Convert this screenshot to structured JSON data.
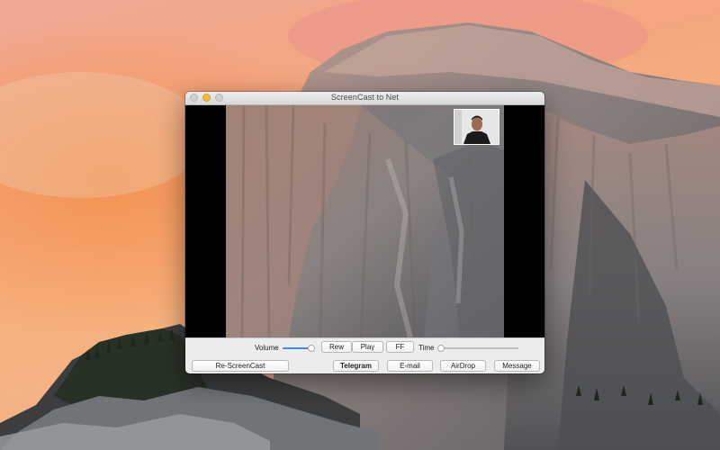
{
  "window": {
    "title": "ScreenCast to Net"
  },
  "controls": {
    "volume_label": "Volume",
    "volume_level": 0.9,
    "time_label": "Time",
    "time_position": 0.0,
    "rew_label": "Rew",
    "play_label": "Play",
    "ff_label": "FF",
    "rescreencast_label": "Re-ScreenCast",
    "telegram_label": "Telegram",
    "email_label": "E-mail",
    "airdrop_label": "AirDrop",
    "message_label": "Message"
  },
  "colors": {
    "accent": "#3b8df0",
    "minimize": "#f4b93d"
  },
  "icons": {
    "close": "close-icon",
    "minimize": "minimize-icon",
    "zoom": "zoom-icon"
  }
}
